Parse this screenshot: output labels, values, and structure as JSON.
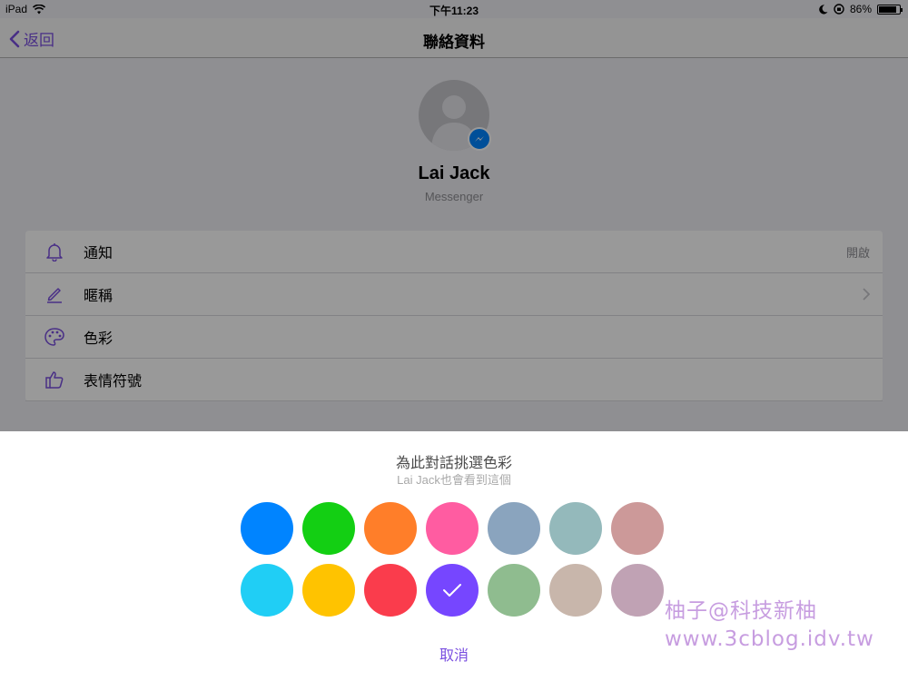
{
  "statusbar": {
    "device": "iPad",
    "time": "下午11:23",
    "battery": "86%",
    "battery_level": 0.86
  },
  "navbar": {
    "back_label": "返回",
    "title": "聯絡資料"
  },
  "profile": {
    "name": "Lai Jack",
    "sub": "Messenger"
  },
  "settings": {
    "rows": [
      {
        "label": "通知",
        "value": "開啟",
        "icon": "bell-icon"
      },
      {
        "label": "暱稱",
        "icon": "pencil-icon"
      },
      {
        "label": "色彩",
        "icon": "palette-icon"
      },
      {
        "label": "表情符號",
        "icon": "thumbs-up-icon"
      }
    ]
  },
  "color_sheet": {
    "title": "為此對話挑選色彩",
    "subtitle": "Lai Jack也會看到這個",
    "cancel_label": "取消",
    "colors_row1": [
      "#0084ff",
      "#13cf13",
      "#ff7e29",
      "#ff5ca1",
      "#8aa4be",
      "#94b9bb",
      "#cc9999"
    ],
    "colors_row2": [
      "#20cef5",
      "#ffc300",
      "#fa3c4c",
      "#7646ff",
      "#8fbc8f",
      "#c8b6ab",
      "#c0a2b4"
    ],
    "selected": "#7646ff"
  },
  "accent_color": "#7a4fe0",
  "watermark": {
    "line1": "柚子@科技新柚",
    "line2": "www.3cblog.idv.tw"
  }
}
